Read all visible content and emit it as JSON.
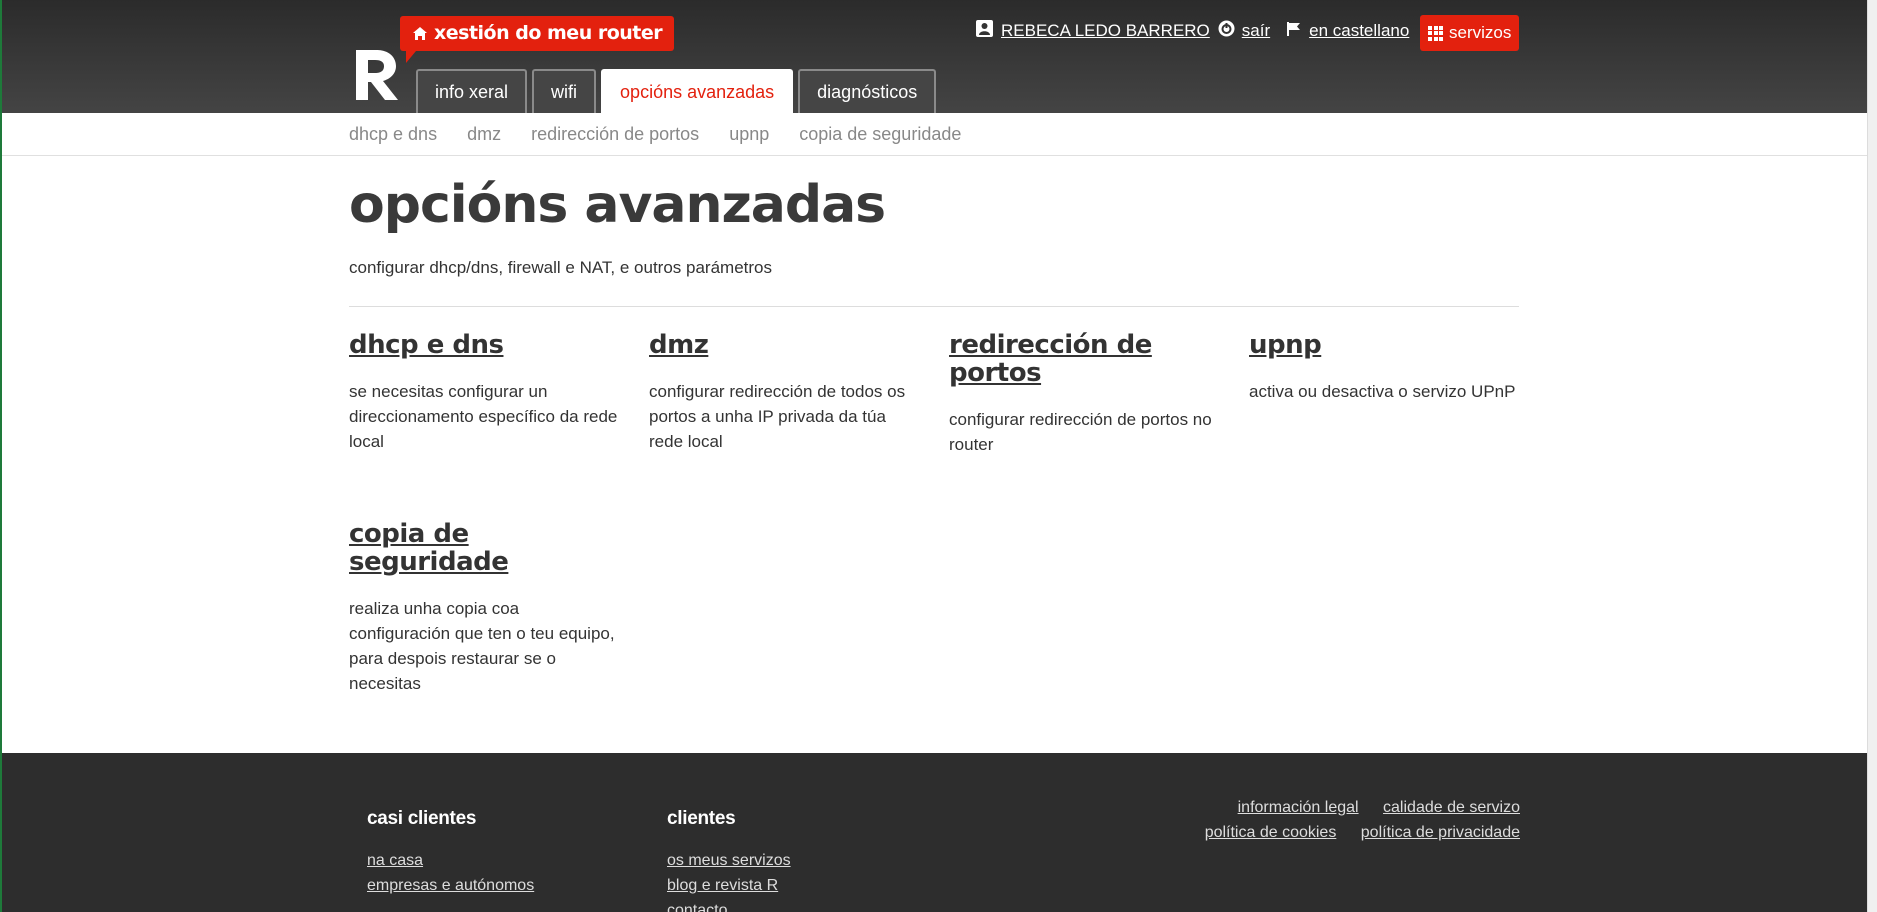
{
  "header": {
    "brand_label": "xestión do meu router",
    "tabs": [
      {
        "label": "info xeral"
      },
      {
        "label": "wifi"
      },
      {
        "label": "opcións avanzadas"
      },
      {
        "label": "diagnósticos"
      }
    ],
    "user_name": "REBECA LEDO BARRERO",
    "logout_label": "saír",
    "language_label": "en castellano",
    "services_label": "servizos"
  },
  "subnav": {
    "items": [
      "dhcp e dns",
      "dmz",
      "redirección de portos",
      "upnp",
      "copia de seguridade"
    ]
  },
  "main": {
    "title": "opcións avanzadas",
    "subtitle": "configurar dhcp/dns, firewall e NAT, e outros parámetros",
    "cards": [
      {
        "title": "dhcp e dns",
        "text": "se necesitas configurar un direccionamento específico da rede local"
      },
      {
        "title": "dmz",
        "text": "configurar redirección de todos os portos a unha IP privada da túa rede local"
      },
      {
        "title": "redirección de portos",
        "text": "configurar redirección de portos no router"
      },
      {
        "title": "upnp",
        "text": "activa ou desactiva o servizo UPnP"
      },
      {
        "title": "copia de seguridade",
        "text": "realiza unha copia coa configuración que ten o teu equipo, para despois restaurar se o necesitas"
      }
    ]
  },
  "footer": {
    "col1": {
      "heading": "casi clientes",
      "links": [
        "na casa",
        "empresas e autónomos"
      ]
    },
    "col2": {
      "heading": "clientes",
      "links": [
        "os meus servizos",
        "blog e revista R",
        "contacto"
      ]
    },
    "legal": [
      "información legal",
      "calidade de servizo",
      "política de cookies",
      "política de privacidade"
    ]
  },
  "colors": {
    "accent": "#e3210e",
    "header_bg": "#2b2b2b",
    "footer_bg": "#2d2d2d"
  }
}
